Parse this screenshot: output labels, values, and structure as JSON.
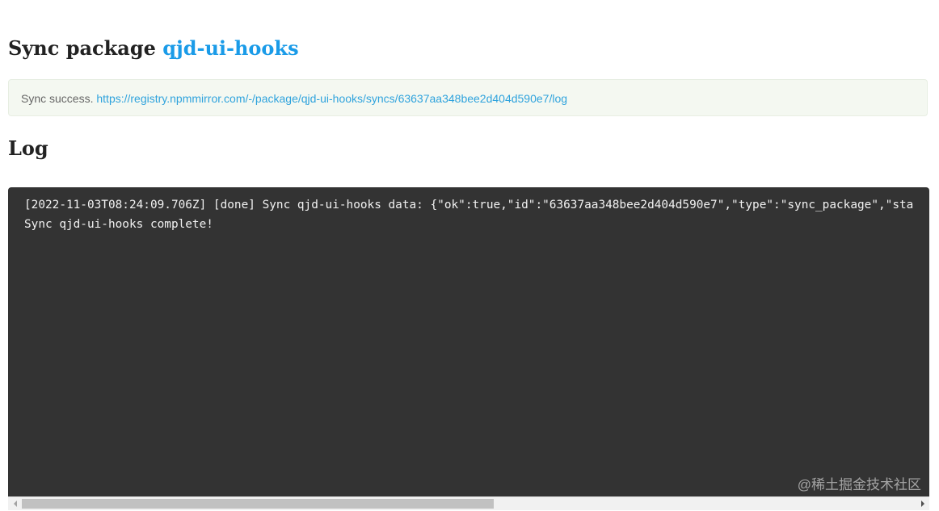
{
  "header": {
    "title_prefix": "Sync package",
    "package_name": "qjd-ui-hooks"
  },
  "alert": {
    "status_text": "Sync success.",
    "log_url": "https://registry.npmmirror.com/-/package/qjd-ui-hooks/syncs/63637aa348bee2d404d590e7/log"
  },
  "log_section": {
    "title": "Log"
  },
  "terminal": {
    "lines": [
      "[2022-11-03T08:24:09.706Z] [done] Sync qjd-ui-hooks data: {\"ok\":true,\"id\":\"63637aa348bee2d404d590e7\",\"type\":\"sync_package\",\"sta",
      "Sync qjd-ui-hooks complete!"
    ],
    "watermark": "@稀土掘金技术社区"
  },
  "scrollbar": {
    "left_arrow_icon": "scroll-left-arrow-icon",
    "right_arrow_icon": "scroll-right-arrow-icon"
  },
  "colors": {
    "link": "#1a9be8",
    "alert_background": "#f4f8f1",
    "terminal_background": "#333333"
  }
}
